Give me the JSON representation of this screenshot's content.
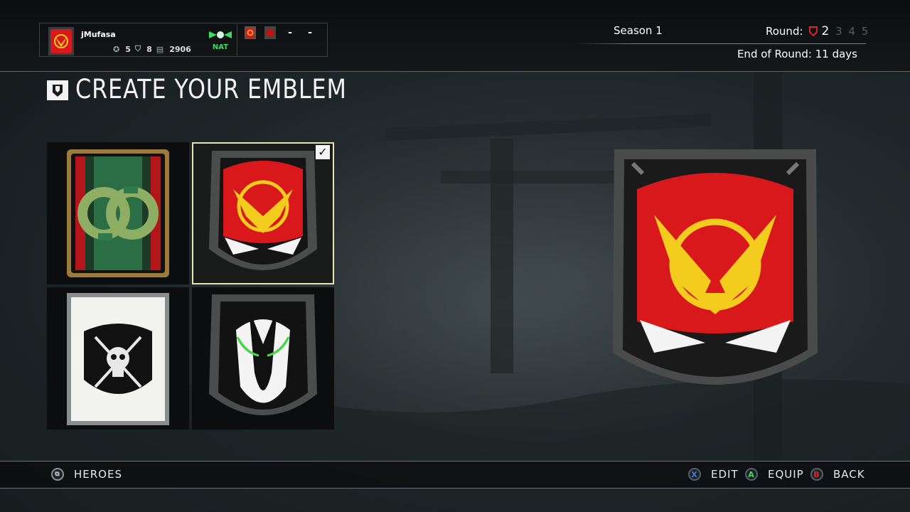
{
  "player": {
    "name": "jMufasa",
    "stat1": "5",
    "stat2": "8",
    "stat3": "2906",
    "stat1_icon": "medal-icon",
    "stat2_icon": "helmet-icon",
    "stat3_icon": "steel-icon"
  },
  "faction": {
    "label": "NAT",
    "color": "#3ddc62"
  },
  "orders": {
    "slot3": "-",
    "slot4": "-"
  },
  "season": {
    "label": "Season 1"
  },
  "round": {
    "label": "Round:",
    "rounds": [
      "2",
      "3",
      "4",
      "5"
    ],
    "current": "2"
  },
  "end_of_round": "End of Round: 11 days",
  "title": "CREATE YOUR EMBLEM",
  "emblems": [
    {
      "name": "green-ring-emblem",
      "selected": false
    },
    {
      "name": "phoenix-emblem",
      "selected": true
    },
    {
      "name": "skull-crossed-swords-emblem",
      "selected": false
    },
    {
      "name": "demon-emblem",
      "selected": false
    }
  ],
  "preview": {
    "name": "phoenix-emblem"
  },
  "footer": {
    "heroes_label": "HEROES",
    "edit_button": "X",
    "edit_label": "EDIT",
    "equip_button": "A",
    "equip_label": "EQUIP",
    "back_button": "B",
    "back_label": "BACK"
  },
  "colors": {
    "accent_selected": "#e9e3b2",
    "emblem_red": "#d8181a",
    "emblem_yellow": "#f4cc1e",
    "button_x": "#3d7fd9",
    "button_a": "#3ddc62",
    "button_b": "#d8262b"
  }
}
